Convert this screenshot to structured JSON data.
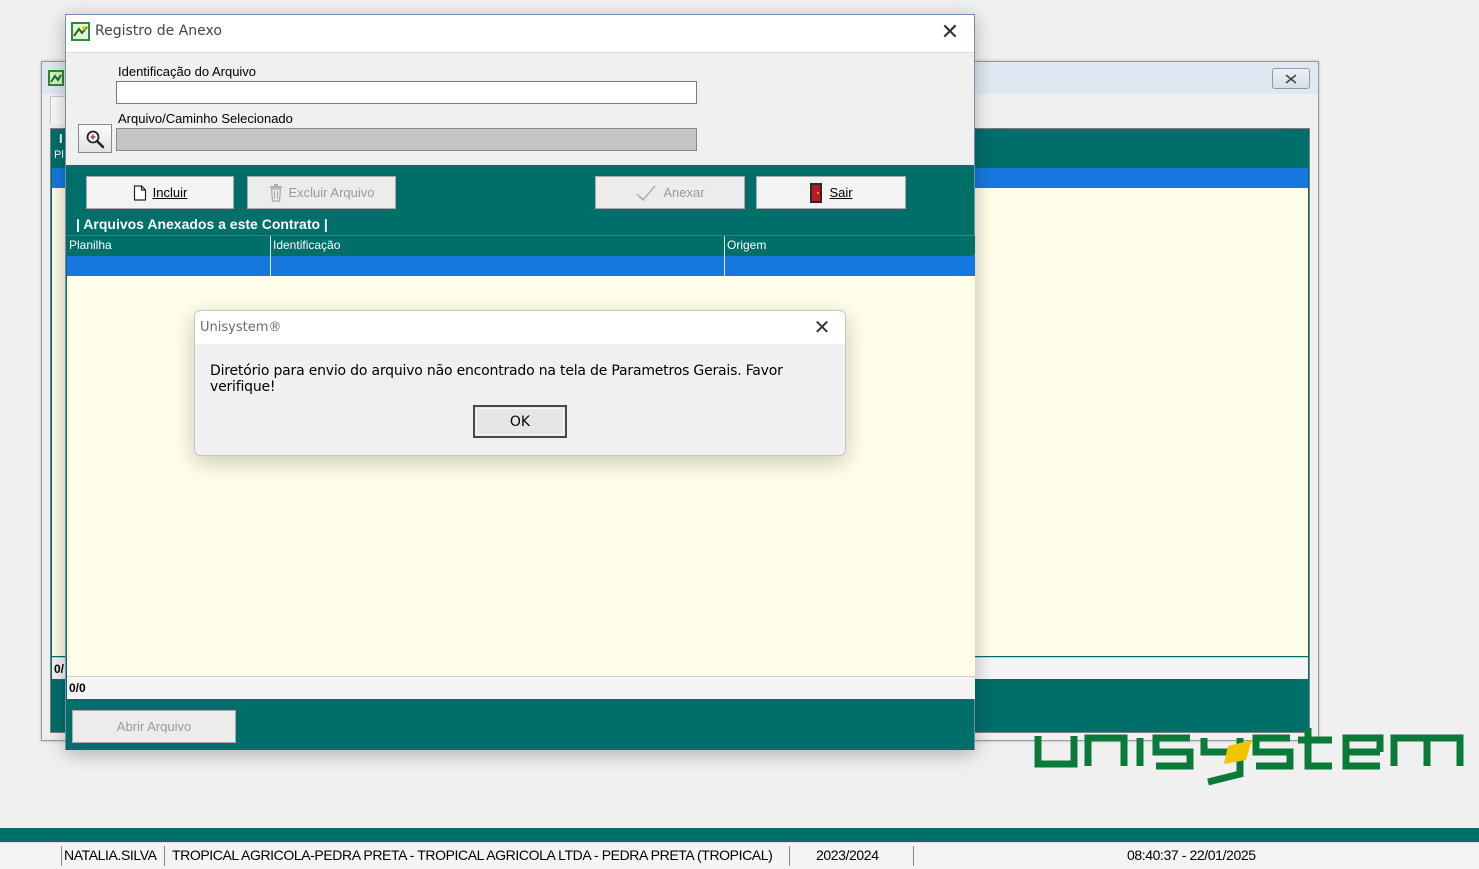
{
  "background_window": {
    "left_labels": [
      "I",
      "Pl",
      "0/"
    ]
  },
  "logo": {
    "text": "unisystem",
    "color": "#0a7a3a",
    "accent": "#f2c400"
  },
  "anexo_dialog": {
    "title": "Registro de Anexo",
    "close_glyph": "✕",
    "fields": {
      "identificacao_label": "Identificação do Arquivo",
      "identificacao_value": "",
      "caminho_label": "Arquivo/Caminho Selecionado",
      "caminho_value": ""
    },
    "buttons": {
      "incluir": "Incluir",
      "excluir": "Excluir Arquivo",
      "anexar": "Anexar",
      "sair": "Sair",
      "abrir": "Abrir Arquivo"
    },
    "grid": {
      "group_label": "| Arquivos Anexados a este Contrato |",
      "columns": [
        "Planilha",
        "Identificação",
        "Origem"
      ],
      "footer": "0/0"
    }
  },
  "message_box": {
    "title": "Unisystem®",
    "close_glyph": "✕",
    "text": "Diretório para envio do arquivo não encontrado na tela de Parametros Gerais. Favor verifique!",
    "ok": "OK"
  },
  "status_bar": {
    "user": "NATALIA.SILVA",
    "company": "TROPICAL AGRICOLA-PEDRA PRETA - TROPICAL AGRICOLA LTDA - PEDRA PRETA (TROPICAL)",
    "season": "2023/2024",
    "datetime": "08:40:37 - 22/01/2025"
  },
  "colors": {
    "teal": "#006f6a",
    "selection_blue": "#1678df",
    "grid_bg": "#fffee8"
  }
}
